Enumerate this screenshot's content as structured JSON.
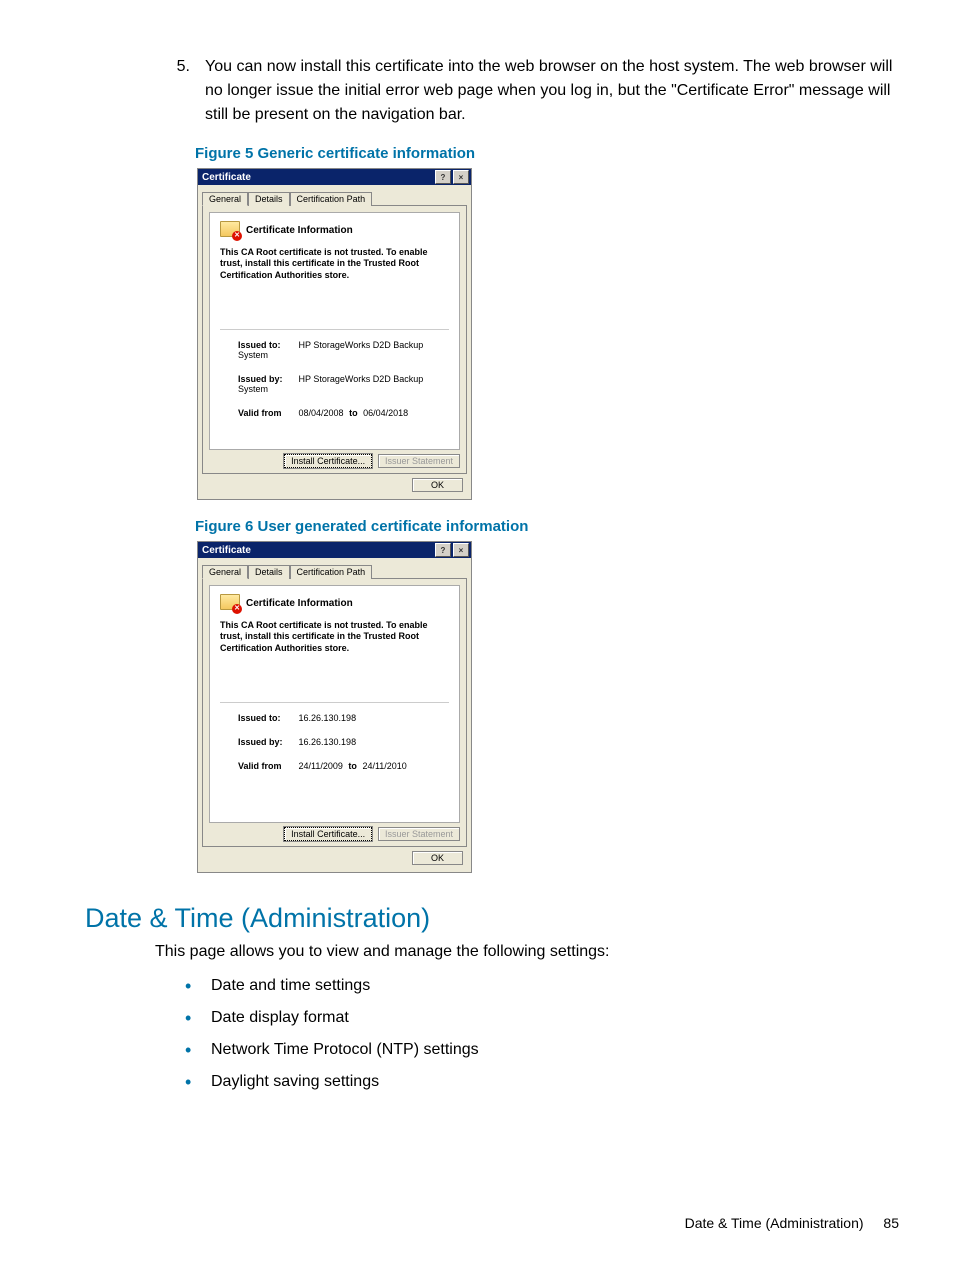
{
  "step": {
    "number": "5.",
    "text": "You can now install this certificate into the web browser on the host system. The web browser will no longer issue the initial error web page when you log in, but the \"Certificate Error\" message will still be present on the navigation bar."
  },
  "figure5": {
    "caption": "Figure 5 Generic certificate information",
    "window_title": "Certificate",
    "tabs": {
      "general": "General",
      "details": "Details",
      "certpath": "Certification Path"
    },
    "info_header": "Certificate Information",
    "warning": "This CA Root certificate is not trusted. To enable trust, install this certificate in the Trusted Root Certification Authorities store.",
    "issued_to_label": "Issued to:",
    "issued_to": "HP StorageWorks D2D Backup System",
    "issued_by_label": "Issued by:",
    "issued_by": "HP StorageWorks D2D Backup System",
    "valid_label": "Valid from",
    "valid_from": "08/04/2008",
    "valid_to_label": "to",
    "valid_to": "06/04/2018",
    "btn_install": "Install Certificate...",
    "btn_issuer": "Issuer Statement",
    "btn_ok": "OK"
  },
  "figure6": {
    "caption": "Figure 6 User generated certificate information",
    "window_title": "Certificate",
    "tabs": {
      "general": "General",
      "details": "Details",
      "certpath": "Certification Path"
    },
    "info_header": "Certificate Information",
    "warning": "This CA Root certificate is not trusted. To enable trust, install this certificate in the Trusted Root Certification Authorities store.",
    "issued_to_label": "Issued to:",
    "issued_to": "16.26.130.198",
    "issued_by_label": "Issued by:",
    "issued_by": "16.26.130.198",
    "valid_label": "Valid from",
    "valid_from": "24/11/2009",
    "valid_to_label": "to",
    "valid_to": "24/11/2010",
    "btn_install": "Install Certificate...",
    "btn_issuer": "Issuer Statement",
    "btn_ok": "OK"
  },
  "section": {
    "heading": "Date & Time (Administration)",
    "intro": "This page allows you to view and manage the following settings:",
    "bullets": [
      "Date and time settings",
      "Date display format",
      "Network Time Protocol (NTP) settings",
      "Daylight saving settings"
    ]
  },
  "footer": {
    "label": "Date & Time (Administration)",
    "page": "85"
  }
}
